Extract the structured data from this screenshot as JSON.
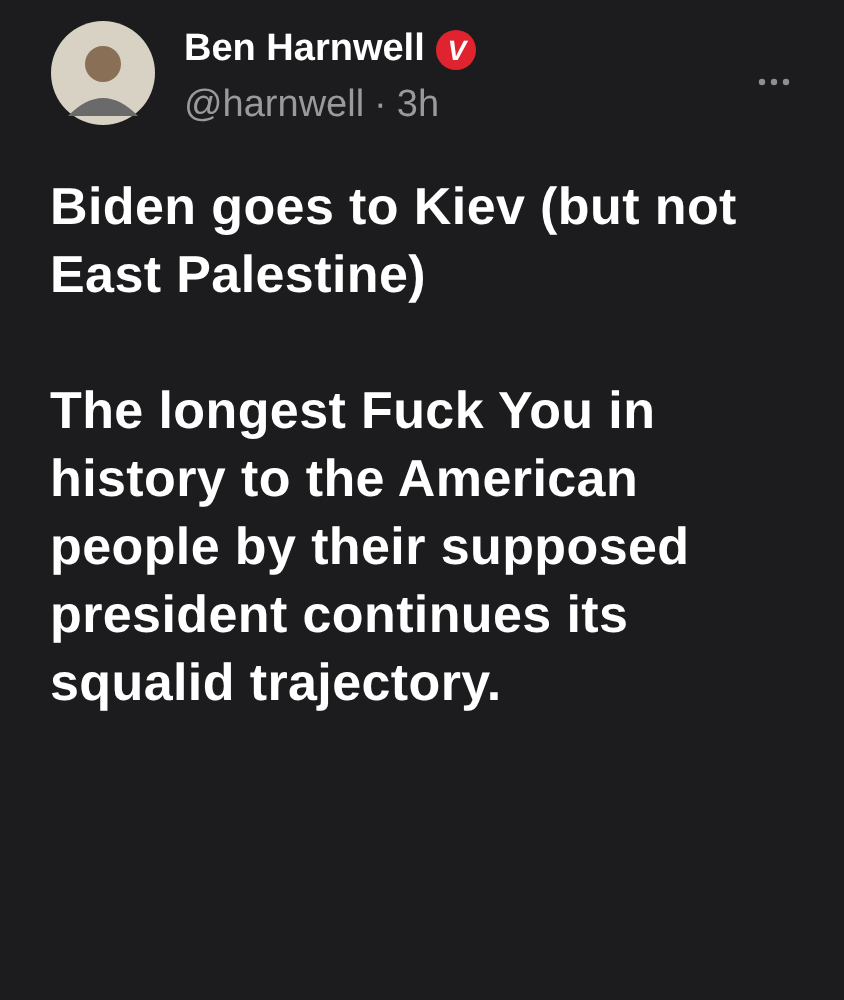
{
  "author": {
    "name": "Ben Harnwell",
    "badge": "V",
    "handle": "@harnwell",
    "separator": "·",
    "time": "3h"
  },
  "paragraphs": [
    "Biden goes to Kiev (but not East Palestine)",
    "The longest Fuck You in history to the American people by their supposed president continues its squalid trajectory."
  ]
}
